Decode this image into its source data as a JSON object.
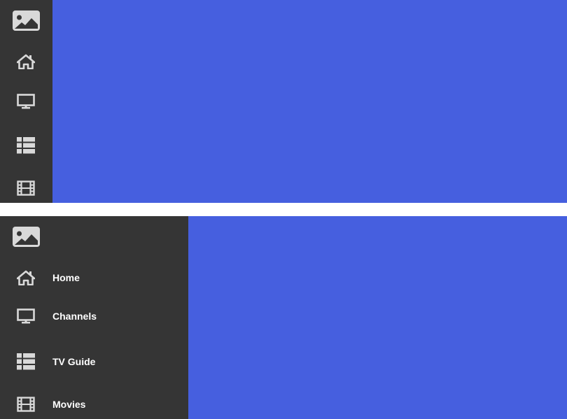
{
  "colors": {
    "sidebar_bg": "#353535",
    "content_bg": "#465fdf",
    "icon_color": "#d9d9d9",
    "label_color": "#ffffff"
  },
  "sidebar_collapsed": {
    "items": [
      {
        "icon": "home-icon"
      },
      {
        "icon": "monitor-icon"
      },
      {
        "icon": "list-icon"
      },
      {
        "icon": "film-icon"
      }
    ]
  },
  "sidebar_expanded": {
    "items": [
      {
        "icon": "home-icon",
        "label": "Home"
      },
      {
        "icon": "monitor-icon",
        "label": "Channels"
      },
      {
        "icon": "list-icon",
        "label": "TV Guide"
      },
      {
        "icon": "film-icon",
        "label": "Movies"
      }
    ]
  }
}
